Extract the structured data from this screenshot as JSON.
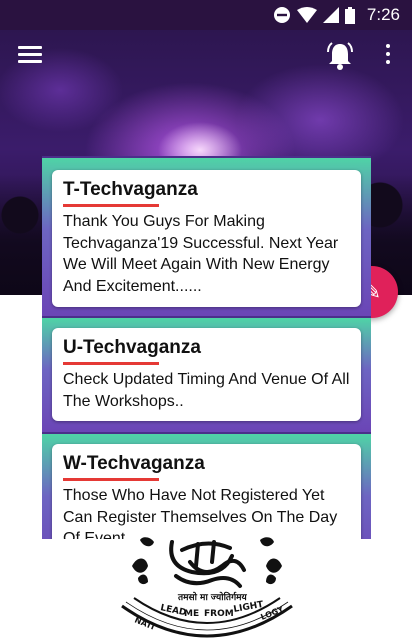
{
  "status_bar": {
    "time": "7:26"
  },
  "toolbar": {
    "menu_icon": "hamburger-menu-icon",
    "bell_icon": "bell-ringing-icon",
    "more_icon": "more-vertical-icon"
  },
  "colors": {
    "status_bar": "#2a1240",
    "card_rule": "#e53935",
    "fab": "#e0215a",
    "panel_top": "#4fd3a6",
    "panel_bottom": "#6b45b6"
  },
  "notifications": [
    {
      "title": "T-Techvaganza",
      "body": "Thank You Guys For Making Techvaganza'19 Successful. Next Year We Will Meet Again With New Energy And Excitement......"
    },
    {
      "title": "U-Techvaganza",
      "body": "Check Updated Timing And Venue Of All The Workshops.."
    },
    {
      "title": "W-Techvaganza",
      "body": "Those Who Have Not Registered Yet Can Register Themselves On The Day Of Event.."
    }
  ],
  "logo": {
    "ring_text": "LEAD ME FROM DARKNESS TO LIGHT",
    "outer_text": "NATIONAL INSTITUTE OF TECHNOLOGY",
    "hindi_text": "तमसो मा ज्योतिर्गमय"
  }
}
